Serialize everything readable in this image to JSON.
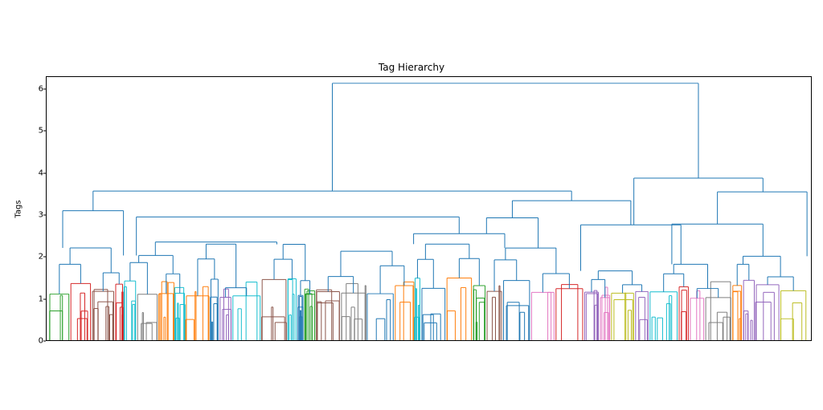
{
  "chart_data": {
    "type": "dendrogram",
    "title": "Tag Hierarchy",
    "xlabel": "",
    "ylabel": "Tags",
    "ylim": [
      0,
      6.3
    ],
    "yticks": [
      0,
      1,
      2,
      3,
      4,
      5,
      6
    ],
    "n_leaves_approx": 260,
    "color_threshold_approx": 1.5,
    "cluster_colors": [
      "#ff7f0e",
      "#d62728",
      "#2ca02c",
      "#17becf",
      "#8c564b",
      "#e377c2",
      "#bcbd22",
      "#7f7f7f",
      "#9467bd",
      "#1f77b4"
    ],
    "top_merges": [
      {
        "height": 6.15,
        "left_x_frac": 0.373,
        "right_x_frac": 0.855
      },
      {
        "height": 3.88,
        "left_x_frac": 0.77,
        "right_x_frac": 0.94
      },
      {
        "height": 3.57,
        "left_x_frac": 0.058,
        "right_x_frac": 0.688
      },
      {
        "height": 3.55,
        "left_x_frac": 0.88,
        "right_x_frac": 0.998
      },
      {
        "height": 3.34,
        "left_x_frac": 0.61,
        "right_x_frac": 0.766
      },
      {
        "height": 3.1,
        "left_x_frac": 0.018,
        "right_x_frac": 0.098
      },
      {
        "height": 2.95,
        "left_x_frac": 0.115,
        "right_x_frac": 0.54
      },
      {
        "height": 2.93,
        "left_x_frac": 0.576,
        "right_x_frac": 0.644
      },
      {
        "height": 2.78,
        "left_x_frac": 0.82,
        "right_x_frac": 0.94
      },
      {
        "height": 2.76,
        "left_x_frac": 0.7,
        "right_x_frac": 0.832
      },
      {
        "height": 2.55,
        "left_x_frac": 0.48,
        "right_x_frac": 0.6
      },
      {
        "height": 2.35,
        "left_x_frac": 0.14,
        "right_x_frac": 0.3
      }
    ],
    "note": "Leaf-level merges (heights < ~1.5) are too dense to read individual values from pixels; they form colored clusters spanning the full x-axis with merge heights roughly between 0.4 and 1.5."
  }
}
